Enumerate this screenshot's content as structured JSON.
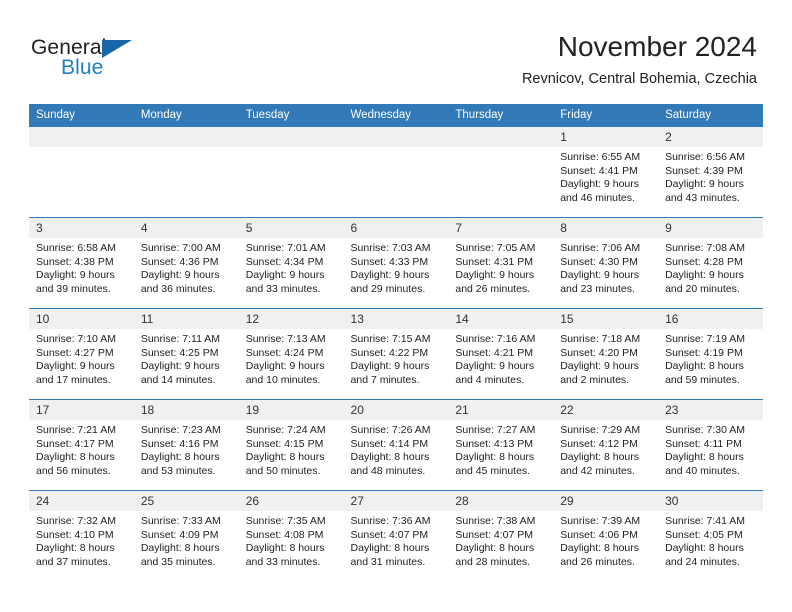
{
  "brand": {
    "name_top": "General",
    "name_bottom": "Blue",
    "flag_icon": "triangle-flag-icon",
    "accent_color": "#1f7fc4"
  },
  "header": {
    "title": "November 2024",
    "subtitle": "Revnicov, Central Bohemia, Czechia"
  },
  "theme": {
    "header_blue": "#3279b7",
    "daynum_gray": "#f0f0f0"
  },
  "calendar": {
    "weekday_headers": [
      "Sunday",
      "Monday",
      "Tuesday",
      "Wednesday",
      "Thursday",
      "Friday",
      "Saturday"
    ],
    "weeks": [
      [
        {
          "day": "",
          "empty": true,
          "lines": []
        },
        {
          "day": "",
          "empty": true,
          "lines": []
        },
        {
          "day": "",
          "empty": true,
          "lines": []
        },
        {
          "day": "",
          "empty": true,
          "lines": []
        },
        {
          "day": "",
          "empty": true,
          "lines": []
        },
        {
          "day": "1",
          "empty": false,
          "lines": [
            "Sunrise: 6:55 AM",
            "Sunset: 4:41 PM",
            "Daylight: 9 hours",
            "and 46 minutes."
          ]
        },
        {
          "day": "2",
          "empty": false,
          "lines": [
            "Sunrise: 6:56 AM",
            "Sunset: 4:39 PM",
            "Daylight: 9 hours",
            "and 43 minutes."
          ]
        }
      ],
      [
        {
          "day": "3",
          "empty": false,
          "lines": [
            "Sunrise: 6:58 AM",
            "Sunset: 4:38 PM",
            "Daylight: 9 hours",
            "and 39 minutes."
          ]
        },
        {
          "day": "4",
          "empty": false,
          "lines": [
            "Sunrise: 7:00 AM",
            "Sunset: 4:36 PM",
            "Daylight: 9 hours",
            "and 36 minutes."
          ]
        },
        {
          "day": "5",
          "empty": false,
          "lines": [
            "Sunrise: 7:01 AM",
            "Sunset: 4:34 PM",
            "Daylight: 9 hours",
            "and 33 minutes."
          ]
        },
        {
          "day": "6",
          "empty": false,
          "lines": [
            "Sunrise: 7:03 AM",
            "Sunset: 4:33 PM",
            "Daylight: 9 hours",
            "and 29 minutes."
          ]
        },
        {
          "day": "7",
          "empty": false,
          "lines": [
            "Sunrise: 7:05 AM",
            "Sunset: 4:31 PM",
            "Daylight: 9 hours",
            "and 26 minutes."
          ]
        },
        {
          "day": "8",
          "empty": false,
          "lines": [
            "Sunrise: 7:06 AM",
            "Sunset: 4:30 PM",
            "Daylight: 9 hours",
            "and 23 minutes."
          ]
        },
        {
          "day": "9",
          "empty": false,
          "lines": [
            "Sunrise: 7:08 AM",
            "Sunset: 4:28 PM",
            "Daylight: 9 hours",
            "and 20 minutes."
          ]
        }
      ],
      [
        {
          "day": "10",
          "empty": false,
          "lines": [
            "Sunrise: 7:10 AM",
            "Sunset: 4:27 PM",
            "Daylight: 9 hours",
            "and 17 minutes."
          ]
        },
        {
          "day": "11",
          "empty": false,
          "lines": [
            "Sunrise: 7:11 AM",
            "Sunset: 4:25 PM",
            "Daylight: 9 hours",
            "and 14 minutes."
          ]
        },
        {
          "day": "12",
          "empty": false,
          "lines": [
            "Sunrise: 7:13 AM",
            "Sunset: 4:24 PM",
            "Daylight: 9 hours",
            "and 10 minutes."
          ]
        },
        {
          "day": "13",
          "empty": false,
          "lines": [
            "Sunrise: 7:15 AM",
            "Sunset: 4:22 PM",
            "Daylight: 9 hours",
            "and 7 minutes."
          ]
        },
        {
          "day": "14",
          "empty": false,
          "lines": [
            "Sunrise: 7:16 AM",
            "Sunset: 4:21 PM",
            "Daylight: 9 hours",
            "and 4 minutes."
          ]
        },
        {
          "day": "15",
          "empty": false,
          "lines": [
            "Sunrise: 7:18 AM",
            "Sunset: 4:20 PM",
            "Daylight: 9 hours",
            "and 2 minutes."
          ]
        },
        {
          "day": "16",
          "empty": false,
          "lines": [
            "Sunrise: 7:19 AM",
            "Sunset: 4:19 PM",
            "Daylight: 8 hours",
            "and 59 minutes."
          ]
        }
      ],
      [
        {
          "day": "17",
          "empty": false,
          "lines": [
            "Sunrise: 7:21 AM",
            "Sunset: 4:17 PM",
            "Daylight: 8 hours",
            "and 56 minutes."
          ]
        },
        {
          "day": "18",
          "empty": false,
          "lines": [
            "Sunrise: 7:23 AM",
            "Sunset: 4:16 PM",
            "Daylight: 8 hours",
            "and 53 minutes."
          ]
        },
        {
          "day": "19",
          "empty": false,
          "lines": [
            "Sunrise: 7:24 AM",
            "Sunset: 4:15 PM",
            "Daylight: 8 hours",
            "and 50 minutes."
          ]
        },
        {
          "day": "20",
          "empty": false,
          "lines": [
            "Sunrise: 7:26 AM",
            "Sunset: 4:14 PM",
            "Daylight: 8 hours",
            "and 48 minutes."
          ]
        },
        {
          "day": "21",
          "empty": false,
          "lines": [
            "Sunrise: 7:27 AM",
            "Sunset: 4:13 PM",
            "Daylight: 8 hours",
            "and 45 minutes."
          ]
        },
        {
          "day": "22",
          "empty": false,
          "lines": [
            "Sunrise: 7:29 AM",
            "Sunset: 4:12 PM",
            "Daylight: 8 hours",
            "and 42 minutes."
          ]
        },
        {
          "day": "23",
          "empty": false,
          "lines": [
            "Sunrise: 7:30 AM",
            "Sunset: 4:11 PM",
            "Daylight: 8 hours",
            "and 40 minutes."
          ]
        }
      ],
      [
        {
          "day": "24",
          "empty": false,
          "lines": [
            "Sunrise: 7:32 AM",
            "Sunset: 4:10 PM",
            "Daylight: 8 hours",
            "and 37 minutes."
          ]
        },
        {
          "day": "25",
          "empty": false,
          "lines": [
            "Sunrise: 7:33 AM",
            "Sunset: 4:09 PM",
            "Daylight: 8 hours",
            "and 35 minutes."
          ]
        },
        {
          "day": "26",
          "empty": false,
          "lines": [
            "Sunrise: 7:35 AM",
            "Sunset: 4:08 PM",
            "Daylight: 8 hours",
            "and 33 minutes."
          ]
        },
        {
          "day": "27",
          "empty": false,
          "lines": [
            "Sunrise: 7:36 AM",
            "Sunset: 4:07 PM",
            "Daylight: 8 hours",
            "and 31 minutes."
          ]
        },
        {
          "day": "28",
          "empty": false,
          "lines": [
            "Sunrise: 7:38 AM",
            "Sunset: 4:07 PM",
            "Daylight: 8 hours",
            "and 28 minutes."
          ]
        },
        {
          "day": "29",
          "empty": false,
          "lines": [
            "Sunrise: 7:39 AM",
            "Sunset: 4:06 PM",
            "Daylight: 8 hours",
            "and 26 minutes."
          ]
        },
        {
          "day": "30",
          "empty": false,
          "lines": [
            "Sunrise: 7:41 AM",
            "Sunset: 4:05 PM",
            "Daylight: 8 hours",
            "and 24 minutes."
          ]
        }
      ]
    ]
  }
}
